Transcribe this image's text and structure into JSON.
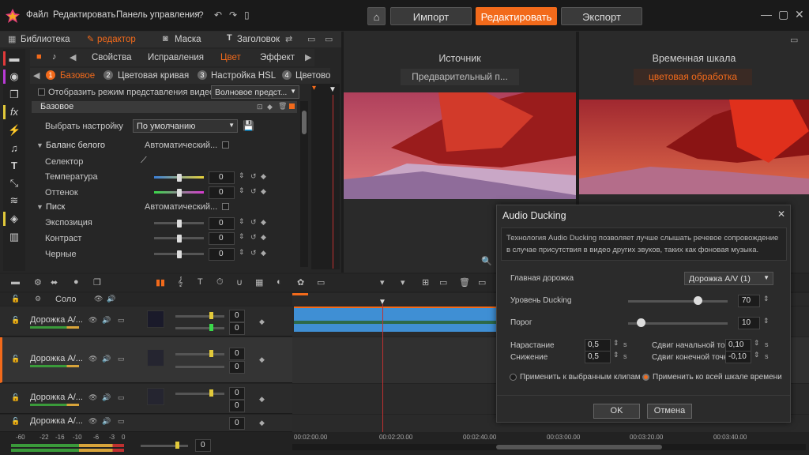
{
  "menu": {
    "file": "Файл",
    "edit": "Редактировать",
    "control_panel": "Панель управления"
  },
  "modes": {
    "import": "Импорт",
    "edit": "Редактировать",
    "export": "Экспорт"
  },
  "left_tabs": {
    "library": "Библиотека",
    "editor": "редактор",
    "mask": "Маска",
    "title": "Заголовок"
  },
  "editor_tabs": {
    "properties": "Свойства",
    "corrections": "Исправления",
    "color": "Цвет",
    "effect": "Эффект"
  },
  "sub_tabs": [
    {
      "num": "1",
      "label": "Базовое"
    },
    {
      "num": "2",
      "label": "Цветовая кривая"
    },
    {
      "num": "3",
      "label": "Настройка HSL"
    },
    {
      "num": "4",
      "label": "Цветово"
    }
  ],
  "display_checkbox": "Отобразить режим представления видео",
  "display_select": "Волновое предст...",
  "section": "Базовое",
  "preset": {
    "label": "Выбрать настройку",
    "value": "По умолчанию"
  },
  "white_balance": {
    "label": "Баланс белого",
    "auto": "Автоматический..."
  },
  "selector": "Селектор",
  "temperature": {
    "label": "Температура",
    "value": "0"
  },
  "tint": {
    "label": "Оттенок",
    "value": "0"
  },
  "peak": {
    "label": "Писк",
    "auto": "Автоматический..."
  },
  "exposure": {
    "label": "Экспозиция",
    "value": "0"
  },
  "contrast": {
    "label": "Контраст",
    "value": "0"
  },
  "blacks": {
    "label": "Черные",
    "value": "0"
  },
  "source": {
    "title": "Источник",
    "sub": "Предварительный п..."
  },
  "timeline": {
    "title": "Временная шкала",
    "sub": "цветовая обработка"
  },
  "track_header": {
    "solo": "Соло"
  },
  "tracks": [
    {
      "name": "Дорожка А/...",
      "v1": "0",
      "v2": "0"
    },
    {
      "name": "Дорожка А/...",
      "v1": "0",
      "v2": "0"
    },
    {
      "name": "Дорожка А/...",
      "v1": "0",
      "v2": "0"
    },
    {
      "name": "Дорожка А/...",
      "v1": "0",
      "v2": "0"
    }
  ],
  "meter_ticks": [
    "-60",
    "-22",
    "-16",
    "-10",
    "-6",
    "-3",
    "0"
  ],
  "master_value": "0",
  "ruler": [
    "00:02:00.00",
    "00:02:20.00",
    "00:02:40.00",
    "00:03:00.00",
    "00:03:20.00",
    "00:03:40.00"
  ],
  "dialog": {
    "title": "Audio Ducking",
    "desc": "Технология Audio Ducking позволяет лучше слышать речевое сопровождение в случае присутствия в видео других звуков, таких как фоновая музыка.",
    "main_track_label": "Главная дорожка",
    "main_track_value": "Дорожка A/V (1)",
    "level_label": "Уровень Ducking",
    "level_value": "70",
    "level_fraction": 0.7,
    "threshold_label": "Порог",
    "threshold_value": "10",
    "threshold_fraction": 0.13,
    "attack_label": "Нарастание",
    "attack_value": "0,5",
    "decay_label": "Снижение",
    "decay_value": "0,5",
    "start_shift_label": "Сдвиг начальной точки",
    "start_shift_value": "0,10",
    "end_shift_label": "Сдвиг конечной точки",
    "end_shift_value": "-0,10",
    "unit": "s",
    "apply_selected": "Применить к выбранным клипам",
    "apply_all": "Применить ко всей шкале времени",
    "ok": "OK",
    "cancel": "Отмена"
  },
  "colors": {
    "accent": "#f26a1b",
    "track_clip": "#3f8fd4"
  }
}
